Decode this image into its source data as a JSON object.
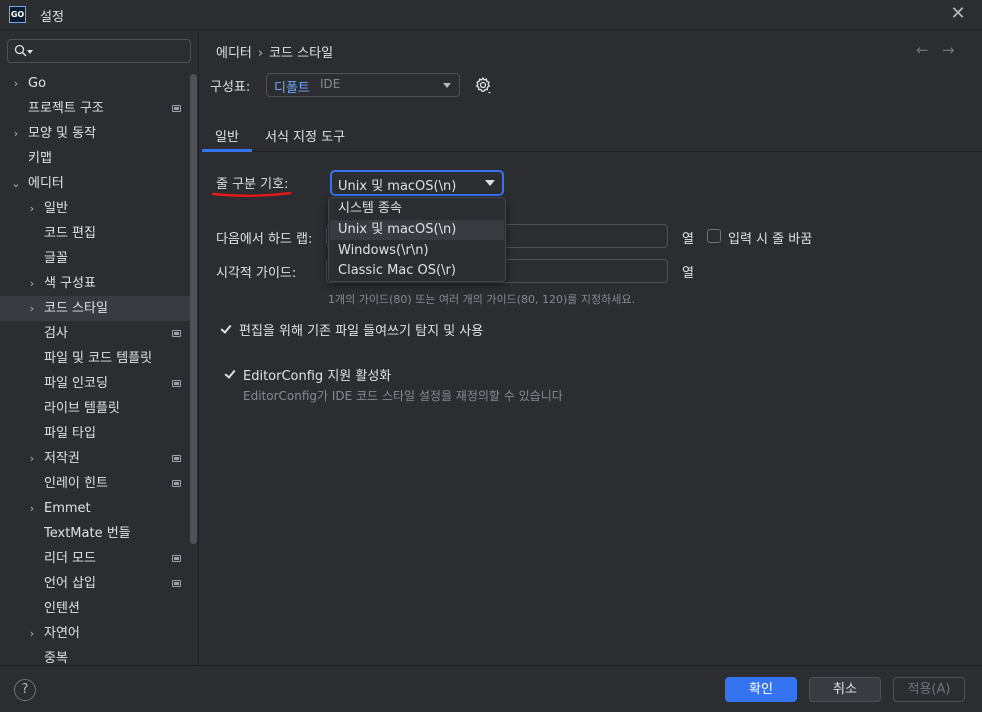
{
  "window": {
    "title": "설정",
    "logo_text": "GO",
    "close_glyph": "✕"
  },
  "search": {
    "placeholder": "",
    "value": ""
  },
  "sidebar": {
    "items": [
      {
        "label": "Go",
        "chevron": "›",
        "project": false
      },
      {
        "label": "프로젝트 구조",
        "chevron": "",
        "project": true
      },
      {
        "label": "모양 및 동작",
        "chevron": "›",
        "project": false
      },
      {
        "label": "키맵",
        "chevron": "",
        "project": false
      },
      {
        "label": "에디터",
        "chevron": "⌄",
        "project": false
      },
      {
        "label": "일반",
        "chevron": "›",
        "project": false
      },
      {
        "label": "코드 편집",
        "chevron": "",
        "project": false
      },
      {
        "label": "글꼴",
        "chevron": "",
        "project": false
      },
      {
        "label": "색 구성표",
        "chevron": "›",
        "project": false
      },
      {
        "label": "코드 스타일",
        "chevron": "›",
        "project": false
      },
      {
        "label": "검사",
        "chevron": "",
        "project": true
      },
      {
        "label": "파일 및 코드 템플릿",
        "chevron": "",
        "project": false
      },
      {
        "label": "파일 인코딩",
        "chevron": "",
        "project": true
      },
      {
        "label": "라이브 템플릿",
        "chevron": "",
        "project": false
      },
      {
        "label": "파일 타입",
        "chevron": "",
        "project": false
      },
      {
        "label": "저작권",
        "chevron": "›",
        "project": true
      },
      {
        "label": "인레이 힌트",
        "chevron": "",
        "project": true
      },
      {
        "label": "Emmet",
        "chevron": "›",
        "project": false
      },
      {
        "label": "TextMate 번들",
        "chevron": "",
        "project": false
      },
      {
        "label": "리더 모드",
        "chevron": "",
        "project": true
      },
      {
        "label": "언어 삽입",
        "chevron": "",
        "project": true
      },
      {
        "label": "인텐션",
        "chevron": "",
        "project": false
      },
      {
        "label": "자연어",
        "chevron": "›",
        "project": false
      },
      {
        "label": "중복",
        "chevron": "",
        "project": false
      }
    ]
  },
  "breadcrumb": {
    "parent": "에디터",
    "separator": "›",
    "current": "코드 스타일"
  },
  "nav": {
    "back": "←",
    "forward": "→"
  },
  "scheme": {
    "label": "구성표:",
    "value": "디폴트",
    "scope": "IDE"
  },
  "tabs": [
    {
      "label": "일반"
    },
    {
      "label": "서식 지정 도구"
    }
  ],
  "form": {
    "line_separator_label": "줄 구분 기호:",
    "line_separator_value": "Unix 및 macOS(\\n)",
    "hard_wrap_label": "다음에서 하드 랩:",
    "hard_wrap_value": "",
    "unit_column": "열",
    "wrap_on_typing_label": "입력 시 줄 바꿈",
    "visual_guides_label": "시각적 가이드:",
    "visual_guides_value": "",
    "visual_guides_hint": "1개의 가이드(80) 또는 여러 개의 가이드(80, 120)를 지정하세요.",
    "detect_indent_label": "편집을 위해 기존 파일 들여쓰기 탐지 및 사용",
    "editorconfig_label": "EditorConfig 지원 활성화",
    "editorconfig_hint": "EditorConfig가 IDE 코드 스타일 설정을 재정의할 수 있습니다"
  },
  "dropdown_options": [
    "시스템 종속",
    "Unix 및 macOS(\\n)",
    "Windows(\\r\\n)",
    "Classic Mac OS(\\r)"
  ],
  "footer": {
    "help": "?",
    "ok": "확인",
    "cancel": "취소",
    "apply": "적용(A)"
  },
  "colors": {
    "accent": "#3574f0",
    "background": "#2b2d30",
    "annotation_red": "#e0191b",
    "link_blue": "#6ea8ff"
  }
}
